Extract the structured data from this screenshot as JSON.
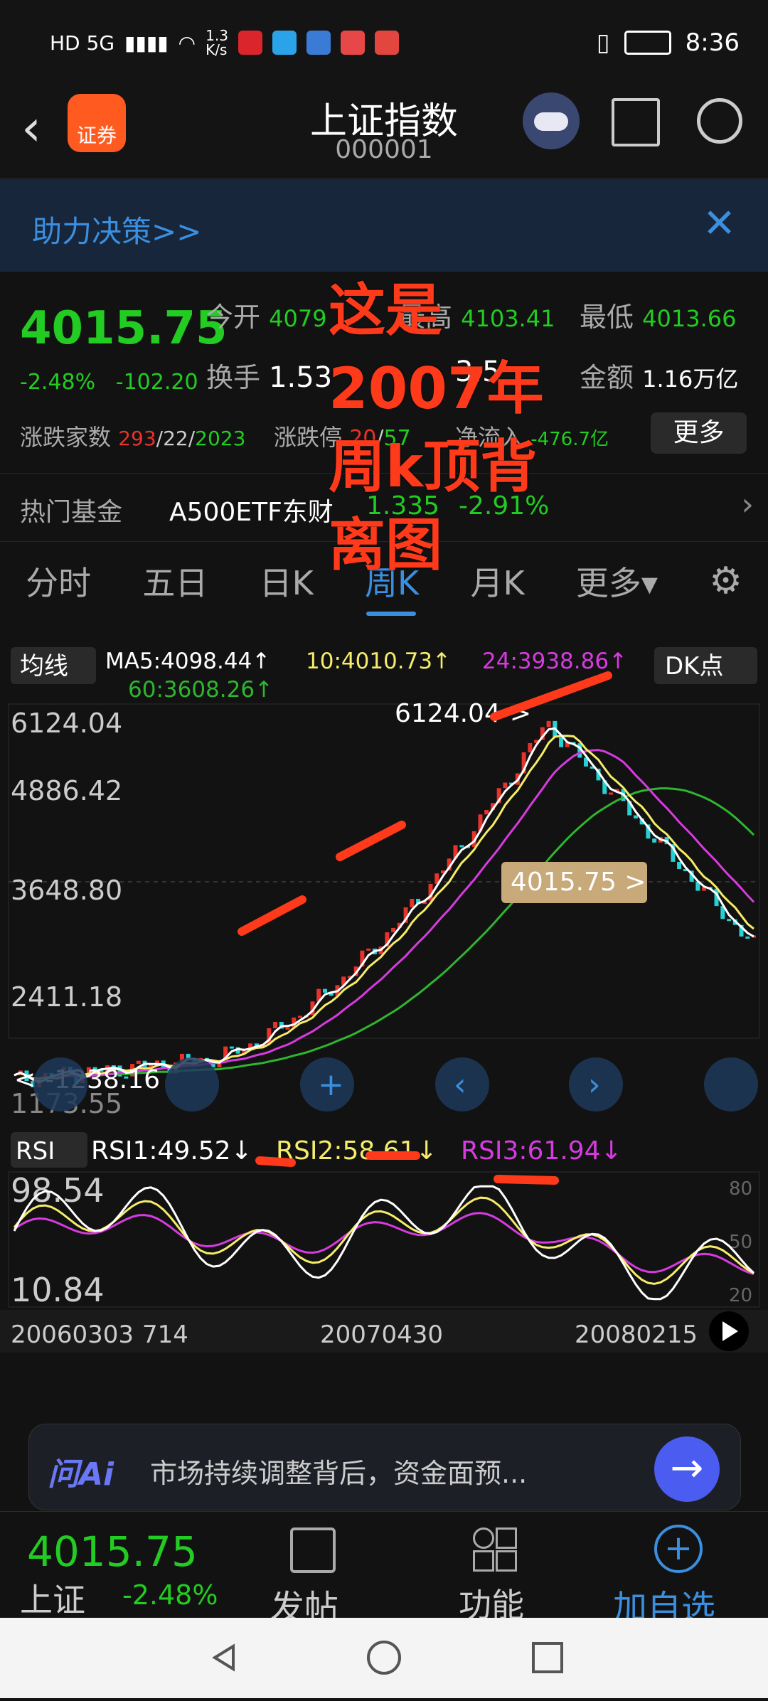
{
  "status_bar": {
    "left_text": "HD 5G",
    "net_speed": "1.3\nK/s",
    "time": "8:36"
  },
  "header": {
    "title": "上证指数",
    "code": "000001",
    "logo_label": "证券"
  },
  "banner": {
    "text": "助力决策>>"
  },
  "quote": {
    "price": "4015.75",
    "change_pct": "-2.48%",
    "change_abs": "-102.20",
    "open_label": "今开",
    "open_value": "4079",
    "high_label": "最高",
    "high_value": "4103.41",
    "low_label": "最低",
    "low_value": "4013.66",
    "turnover_label": "换手",
    "turnover_value": "1.53",
    "ratio_value": "3.5",
    "amount_label": "金额",
    "amount_value": "1.16万亿",
    "breadth_label": "涨跌家数",
    "breadth_up": "293",
    "breadth_flat": "/22/",
    "breadth_down": "2023",
    "limit_label": "涨跌停",
    "limit_up": "20",
    "limit_down": "57",
    "netflow_label": "净流入",
    "netflow_value": "-476.7亿",
    "more_label": "更多"
  },
  "fund": {
    "label": "热门基金",
    "name": "A500ETF东财",
    "value": "1.335",
    "pct": "-2.91%"
  },
  "tabs": [
    "分时",
    "五日",
    "日K",
    "周K",
    "月K",
    "更多▾"
  ],
  "overlay_text": [
    "这是",
    "2007年",
    "周k顶背",
    "离图"
  ],
  "chart": {
    "ma_selector": "均线",
    "ma5": "MA5:4098.44↑",
    "ma10": "10:4010.73↑",
    "ma24": "24:3938.86↑",
    "ma60": "60:3608.26↑",
    "dk_label": "DK点",
    "y_ticks": [
      "6124.04",
      "4886.42",
      "3648.80",
      "2411.18",
      "1173.55"
    ],
    "peak_label": "6124.04->",
    "low_label": "<--1238.16",
    "current_tag": "4015.75 >",
    "rsi_selector": "RSI",
    "rsi1": "RSI1:49.52↓",
    "rsi2": "RSI2:58.61↓",
    "rsi3": "RSI3:61.94↓",
    "rsi_top": "98.54",
    "rsi_bottom": "10.84",
    "rsi_levels": [
      "80",
      "50",
      "20"
    ],
    "x_labels": [
      "20060303",
      "714",
      "20070430",
      "20080215"
    ],
    "colors": {
      "up": "#e8322c",
      "down": "#27d0d4",
      "ma5": "#ffffff",
      "ma10": "#f5ec6a",
      "ma24": "#d63be0",
      "ma60": "#2fb52f",
      "rsi1": "#ffffff",
      "rsi2": "#f5ec6a",
      "rsi3": "#d63be0"
    }
  },
  "ai_bar": {
    "brand": "问Ai",
    "text": "市场持续调整背后，资金面预..."
  },
  "bottom": {
    "price": "4015.75",
    "name": "上证",
    "pct": "-2.48%",
    "post": "发帖",
    "func": "功能",
    "add": "加自选"
  }
}
